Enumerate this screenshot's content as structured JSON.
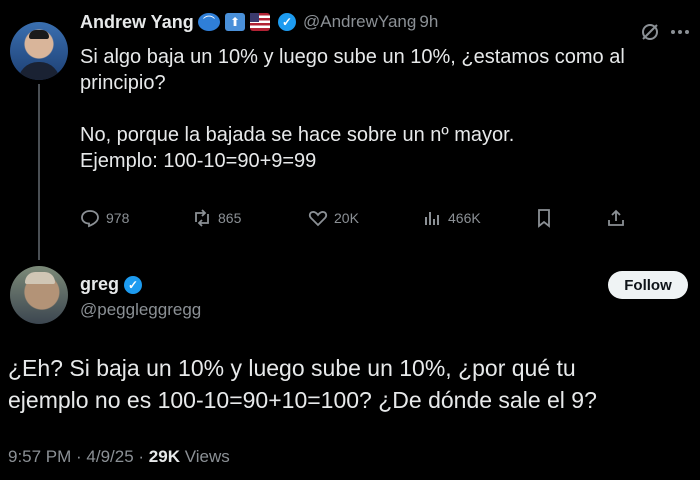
{
  "tweet1": {
    "name": "Andrew Yang",
    "handle": "@AndrewYang",
    "time": "· 9h",
    "body": "Si algo baja un 10% y luego sube un 10%, ¿estamos como al\nprincipio?\n\nNo, porque la bajada se hace sobre un nº mayor.\nEjemplo: 100-10=90+9=99",
    "actions": {
      "replies": "978",
      "retweets": "865",
      "likes": "20K",
      "views": "466K"
    }
  },
  "tweet2": {
    "name": "greg",
    "handle": "@peggleggregg",
    "follow_label": "Follow",
    "body": "¿Eh? Si baja un 10% y luego sube un 10%, ¿por qué tu\nejemplo no es 100-10=90+10=100? ¿De dónde sale el 9?",
    "timestamp": "9:57 PM · 4/9/25 · ",
    "views_count": "29K",
    "views_label": " Views"
  },
  "icons": [
    "verified-badge-icon",
    "blue-cap-emoji-icon",
    "up-arrow-emoji-icon",
    "us-flag-emoji-icon",
    "grok-icon",
    "more-icon",
    "reply-icon",
    "retweet-icon",
    "like-icon",
    "views-icon",
    "bookmark-icon",
    "share-icon"
  ],
  "colors": {
    "background": "#000000",
    "text": "#e7e9ea",
    "muted": "#8b9095",
    "verified": "#1d9bf0"
  }
}
